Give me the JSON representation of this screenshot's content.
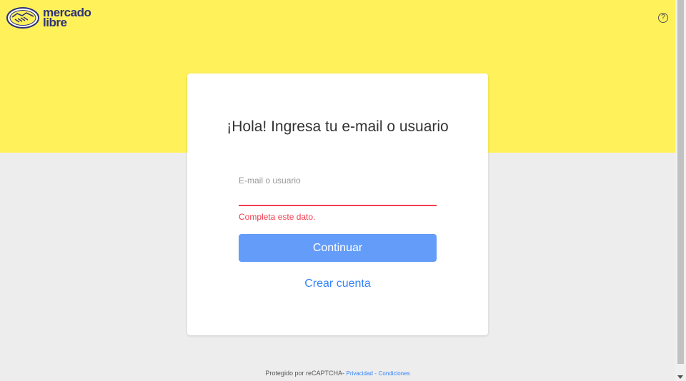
{
  "brand": {
    "line1": "mercado",
    "line2": "libre",
    "colors": {
      "yellow": "#fff159",
      "navy": "#2d3277",
      "blue": "#3483fa",
      "error": "#f23d4f"
    }
  },
  "help": {
    "icon": "help-circle-icon",
    "symbol": "?"
  },
  "login": {
    "title": "¡Hola! Ingresa tu e-mail o usuario",
    "field_label": "E-mail o usuario",
    "field_value": "",
    "error": "Completa este dato.",
    "continue_label": "Continuar",
    "create_account_label": "Crear cuenta"
  },
  "footer": {
    "text": "Protegido por reCAPTCHA-",
    "privacy": "Privacidad",
    "separator": "-",
    "terms": "Condiciones"
  }
}
